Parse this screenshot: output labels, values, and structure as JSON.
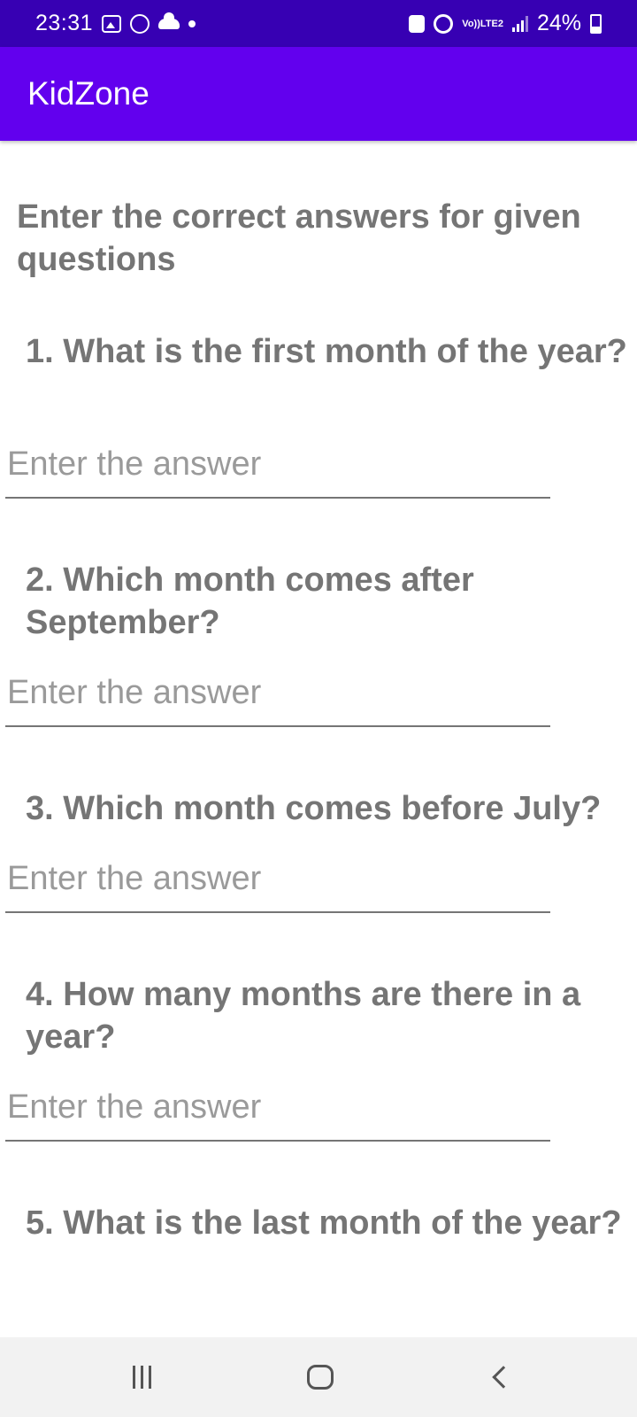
{
  "status_bar": {
    "time": "23:31",
    "volte_line1": "Vo))",
    "volte_line2": "LTE2",
    "battery": "24%",
    "left_icons": [
      "gallery-icon",
      "whatsapp-icon",
      "cloud-icon",
      "dot-icon"
    ],
    "right_icons": [
      "lock-icon",
      "alarm-icon",
      "volte-icon",
      "signal-icon",
      "battery-icon"
    ]
  },
  "app_bar": {
    "title": "KidZone",
    "color": "#6200ee",
    "status_color": "#3700b3"
  },
  "quiz": {
    "instructions": "Enter the correct answers for given questions",
    "questions": [
      {
        "text": "1. What is the first month of the year?",
        "value": "",
        "placeholder": "Enter the answer"
      },
      {
        "text": "2. Which month comes after September?",
        "value": "",
        "placeholder": "Enter the answer"
      },
      {
        "text": "3. Which month comes before July?",
        "value": "",
        "placeholder": "Enter the answer"
      },
      {
        "text": "4. How many months are there in a year?",
        "value": "",
        "placeholder": "Enter the answer"
      },
      {
        "text": "5. What is the last month of the year?"
      }
    ]
  },
  "nav_bar": {
    "buttons": [
      "recents-icon",
      "home-icon",
      "back-icon"
    ]
  }
}
